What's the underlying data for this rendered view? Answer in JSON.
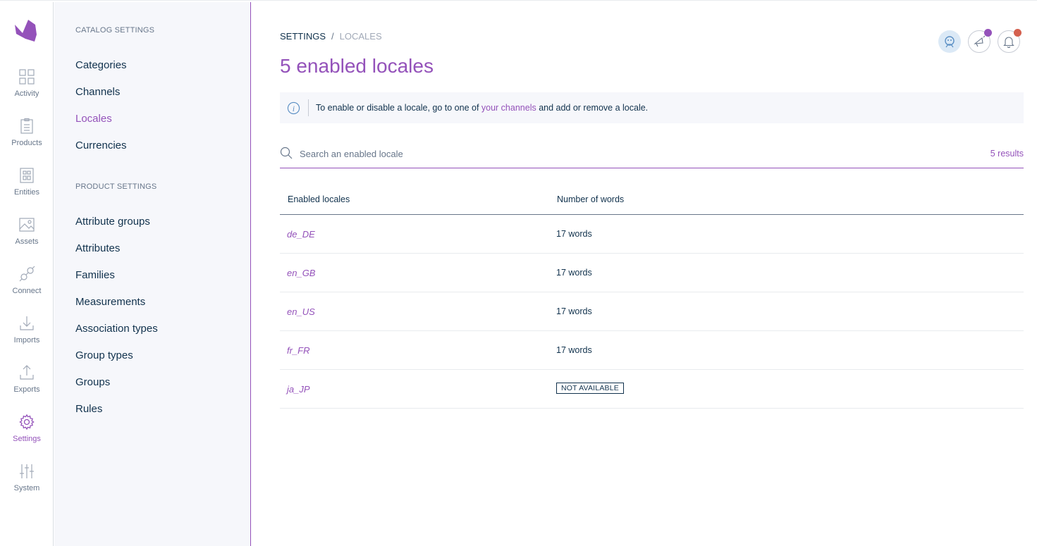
{
  "rail": {
    "items": [
      {
        "label": "Activity"
      },
      {
        "label": "Products"
      },
      {
        "label": "Entities"
      },
      {
        "label": "Assets"
      },
      {
        "label": "Connect"
      },
      {
        "label": "Imports"
      },
      {
        "label": "Exports"
      },
      {
        "label": "Settings"
      },
      {
        "label": "System"
      }
    ],
    "active": "Settings"
  },
  "subnav": {
    "catalog_title": "CATALOG SETTINGS",
    "catalog_items": [
      "Categories",
      "Channels",
      "Locales",
      "Currencies"
    ],
    "product_title": "PRODUCT SETTINGS",
    "product_items": [
      "Attribute groups",
      "Attributes",
      "Families",
      "Measurements",
      "Association types",
      "Group types",
      "Groups",
      "Rules"
    ],
    "active": "Locales"
  },
  "breadcrumb": {
    "root": "SETTINGS",
    "separator": "/",
    "current": "LOCALES"
  },
  "page_title": "5 enabled locales",
  "info": {
    "before": "To enable or disable a locale, go to one of ",
    "link": "your channels",
    "after": " and add or remove a locale."
  },
  "search": {
    "placeholder": "Search an enabled locale",
    "results": "5 results"
  },
  "table": {
    "headers": [
      "Enabled locales",
      "Number of words"
    ],
    "rows": [
      {
        "code": "de_DE",
        "words": "17 words"
      },
      {
        "code": "en_GB",
        "words": "17 words"
      },
      {
        "code": "en_US",
        "words": "17 words"
      },
      {
        "code": "fr_FR",
        "words": "17 words"
      },
      {
        "code": "ja_JP",
        "badge": "NOT AVAILABLE"
      }
    ]
  },
  "icons": {
    "help": "help-avatar-icon",
    "news": "announcement-icon",
    "notifications": "bell-icon"
  },
  "colors": {
    "accent": "#9452ba",
    "news_dot": "#9452ba",
    "notif_dot": "#d4604f",
    "text": "#11324d",
    "muted": "#67768a"
  }
}
